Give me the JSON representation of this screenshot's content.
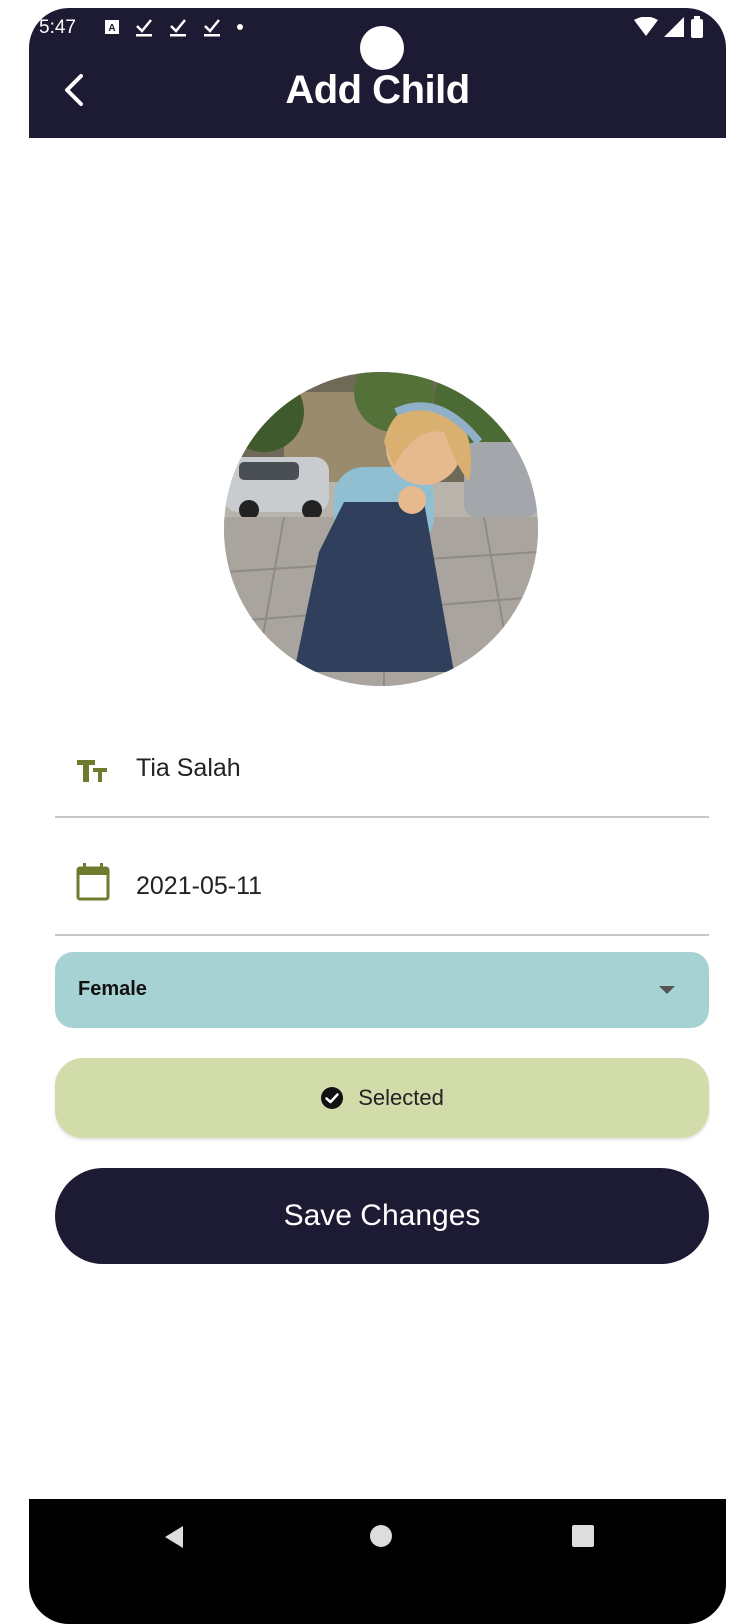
{
  "status_bar": {
    "time": "5:47",
    "icons": [
      "notification-a-icon",
      "check-download-icon",
      "check-download-icon",
      "check-download-icon",
      "dot-icon"
    ],
    "right_icons": [
      "wifi-icon",
      "signal-icon",
      "battery-icon"
    ]
  },
  "header": {
    "title": "Add Child",
    "back_icon": "chevron-left-icon"
  },
  "form": {
    "name_icon": "text-size-icon",
    "name_value": "Tia Salah",
    "dob_icon": "calendar-icon",
    "dob_value": "2021-05-11",
    "gender_selected": "Female",
    "gender_arrow_icon": "dropdown-arrow-icon",
    "selected_chip": {
      "icon": "check-circle-icon",
      "label": "Selected"
    },
    "save_label": "Save Changes"
  },
  "colors": {
    "appbar": "#1c1b33",
    "dropdown_bg": "#a7d2d3",
    "selected_bg": "#d2dbaa",
    "icon_green": "#6f7b2c"
  },
  "nav_bar": {
    "icons": [
      "nav-back-icon",
      "nav-home-icon",
      "nav-recents-icon"
    ]
  }
}
